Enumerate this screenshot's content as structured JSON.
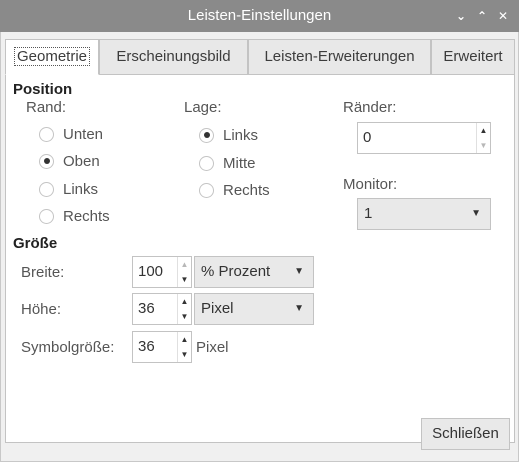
{
  "window": {
    "title": "Leisten-Einstellungen",
    "minimize_icon": "chevron-down-icon",
    "maximize_icon": "chevron-up-icon",
    "close_icon": "close-icon"
  },
  "tabs": [
    {
      "label": "Geometrie",
      "active": true
    },
    {
      "label": "Erscheinungsbild",
      "active": false
    },
    {
      "label": "Leisten-Erweiterungen",
      "active": false
    },
    {
      "label": "Erweitert",
      "active": false
    }
  ],
  "position": {
    "heading": "Position",
    "rand": {
      "label": "Rand:",
      "options": [
        {
          "label": "Unten",
          "selected": false
        },
        {
          "label": "Oben",
          "selected": true
        },
        {
          "label": "Links",
          "selected": false
        },
        {
          "label": "Rechts",
          "selected": false
        }
      ]
    },
    "lage": {
      "label": "Lage:",
      "options": [
        {
          "label": "Links",
          "selected": true
        },
        {
          "label": "Mitte",
          "selected": false
        },
        {
          "label": "Rechts",
          "selected": false
        }
      ]
    },
    "raender": {
      "label": "Ränder:",
      "value": "0"
    },
    "monitor": {
      "label": "Monitor:",
      "value": "1"
    }
  },
  "groesse": {
    "heading": "Größe",
    "breite": {
      "label": "Breite:",
      "value": "100",
      "unit": "% Prozent"
    },
    "hoehe": {
      "label": "Höhe:",
      "value": "36",
      "unit": "Pixel"
    },
    "symbolgroesse": {
      "label": "Symbolgröße:",
      "value": "36",
      "unit": "Pixel"
    }
  },
  "footer": {
    "close_label": "Schließen"
  },
  "colors": {
    "titlebar": "#8a8a8a",
    "panel": "#ffffff",
    "background": "#f0f0f0"
  }
}
